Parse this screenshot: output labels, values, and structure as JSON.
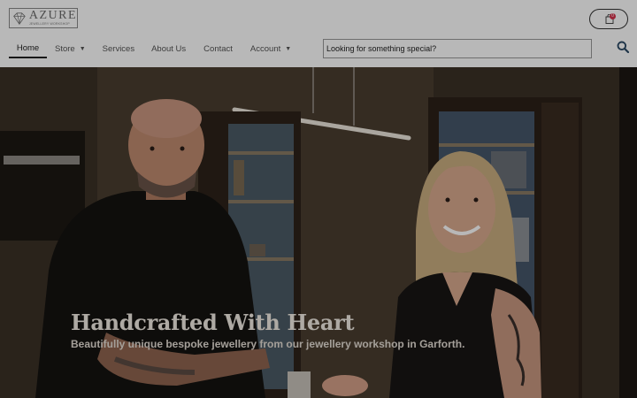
{
  "brand": {
    "name": "AZURE",
    "tagline": "JEWELLERY WORKSHOP",
    "logo_icon": "gem-icon"
  },
  "cart": {
    "count": "0",
    "icon": "shopping-bag-icon",
    "badge_color": "#d6324c"
  },
  "nav": {
    "items": [
      {
        "label": "Home",
        "active": true
      },
      {
        "label": "Store",
        "has_dropdown": true
      },
      {
        "label": "Services"
      },
      {
        "label": "About Us"
      },
      {
        "label": "Contact"
      },
      {
        "label": "Account",
        "has_dropdown": true
      }
    ]
  },
  "search": {
    "placeholder": "Looking for something special?",
    "icon": "search-icon"
  },
  "hero": {
    "title": "Handcrafted With Heart",
    "subtitle": "Beautifully unique bespoke jewellery from our jewellery workshop in Garforth.",
    "image": "photo of two jewellers in workshop",
    "overlay": "dark"
  },
  "colors": {
    "text_dark": "#222222",
    "nav_text": "#555555",
    "hero_text": "#f2ece4"
  }
}
